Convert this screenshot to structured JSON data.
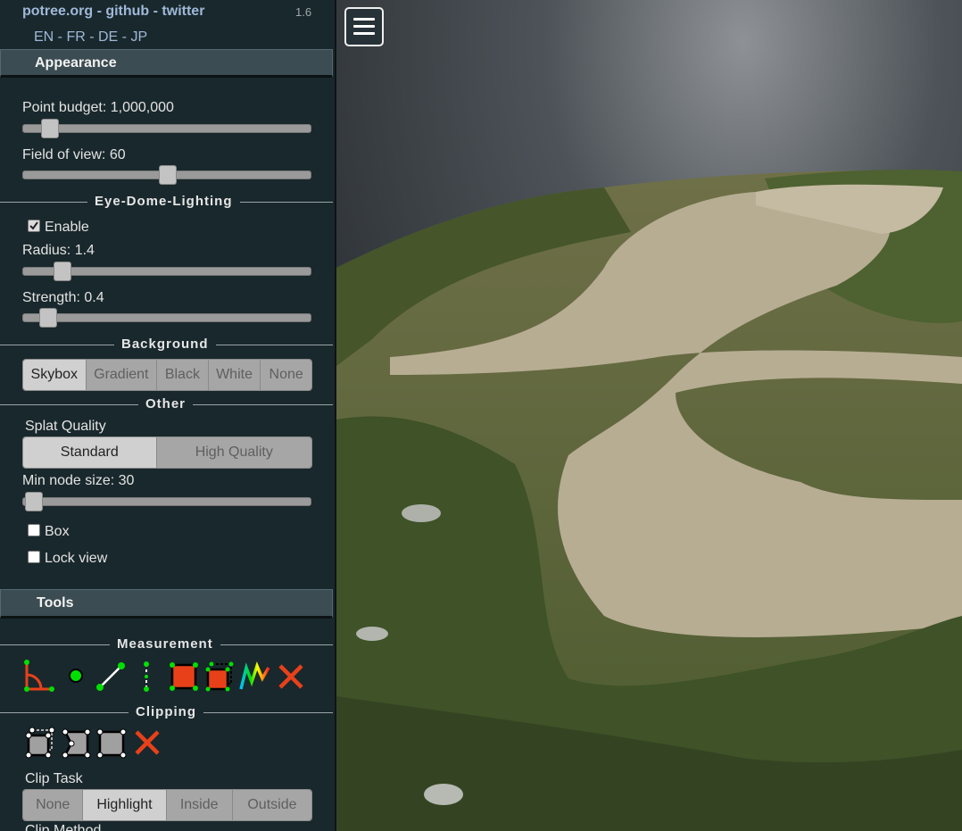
{
  "header": {
    "links": "potree.org - github - twitter",
    "version": "1.6",
    "languages": "EN - FR - DE - JP"
  },
  "appearance": {
    "title": "Appearance",
    "point_budget_label": "Point budget: 1,000,000",
    "point_budget_fraction": 0.08,
    "fov_label": "Field of view: 60",
    "fov_fraction": 0.5
  },
  "edl": {
    "title": "Eye-Dome-Lighting",
    "enable_label": "Enable",
    "enabled": true,
    "radius_label": "Radius: 1.4",
    "radius_fraction": 0.14,
    "strength_label": "Strength: 0.4",
    "strength_fraction": 0.08
  },
  "background": {
    "title": "Background",
    "options": [
      "Skybox",
      "Gradient",
      "Black",
      "White",
      "None"
    ],
    "selected": "Skybox"
  },
  "other": {
    "title": "Other",
    "splat_quality_label": "Splat Quality",
    "splat_options": [
      "Standard",
      "High Quality"
    ],
    "splat_selected": "Standard",
    "min_node_size_label": "Min node size: 30",
    "min_node_size_fraction": 0.0,
    "box_label": "Box",
    "box_checked": false,
    "lock_view_label": "Lock view",
    "lock_view_checked": false
  },
  "tools": {
    "title": "Tools",
    "measurement_title": "Measurement",
    "measurement_icons": [
      "angle-icon",
      "point-icon",
      "distance-icon",
      "height-icon",
      "area-icon",
      "volume-icon",
      "height-profile-icon",
      "remove-measurements-icon"
    ],
    "clipping_title": "Clipping",
    "clipping_icons": [
      "clip-volume-icon",
      "clip-polygon-icon",
      "clip-box-icon",
      "remove-clipping-icon"
    ],
    "clip_task_label": "Clip Task",
    "clip_task_options": [
      "None",
      "Highlight",
      "Inside",
      "Outside"
    ],
    "clip_task_selected": "Highlight",
    "clip_method_label": "Clip Method"
  },
  "colors": {
    "sidebar_bg": "#19282c",
    "link": "#9fb8d8",
    "accent_red": "#e8411a",
    "accent_green": "#00e000"
  }
}
